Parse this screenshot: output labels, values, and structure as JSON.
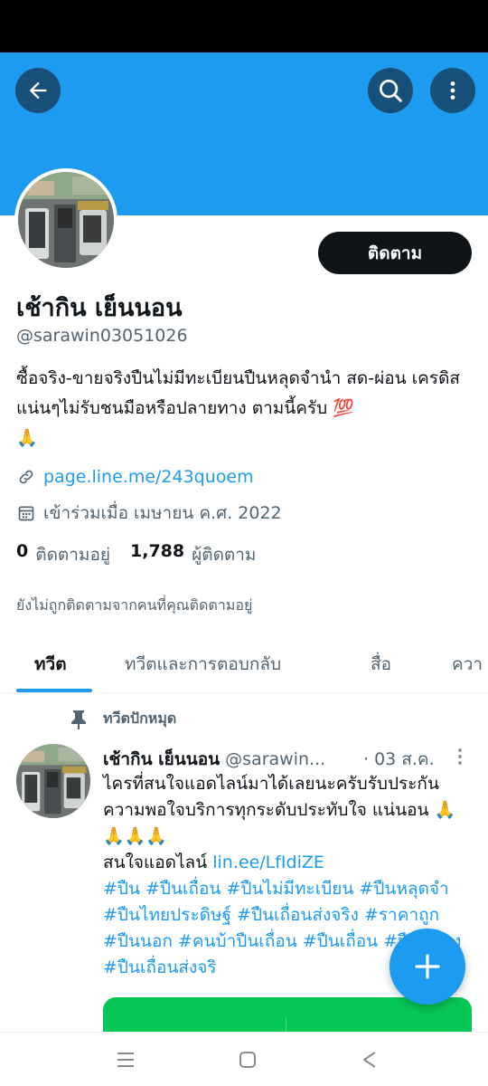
{
  "colors": {
    "accent": "#1d9bf0",
    "banner": "#1d9bf0",
    "header_button": "#19507a",
    "text_primary": "#0f1419",
    "text_secondary": "#536471",
    "line_green": "#06c755"
  },
  "header": {
    "icons": [
      "back-arrow-icon",
      "search-icon",
      "more-vertical-icon"
    ]
  },
  "profile": {
    "follow_label": "ติดตาม",
    "name": "เช้ากิน เย็นนอน",
    "handle": "@sarawin03051026",
    "bio_text": "ซื้อจริง-ขายจริงปืนไม่มีทะเบียนปืนหลุดจำนำ สด-ผ่อน เครดิสแน่นๆไม่รับชนมือหรือปลายทาง ตามนี้ครับ",
    "bio_emoji_100": "💯",
    "bio_emoji_pray": "🙏",
    "link": "page.line.me/243quoem",
    "joined": "เข้าร่วมเมื่อ เมษายน ค.ศ. 2022",
    "following_count": "0",
    "following_label": "ติดตามอยู่",
    "followers_count": "1,788",
    "followers_label": "ผู้ติดตาม",
    "not_followed_note": "ยังไม่ถูกติดตามจากคนที่คุณติดตามอยู่"
  },
  "tabs": [
    {
      "label": "ทวีต",
      "active": true
    },
    {
      "label": "ทวีตและการตอบกลับ",
      "active": false
    },
    {
      "label": "สื่อ",
      "active": false
    },
    {
      "label": "ควา",
      "active": false
    }
  ],
  "pinned_tweet": {
    "pinned_label": "ทวีตปักหมุด",
    "author_name": "เช้ากิน เย็นนอน",
    "author_handle": "@sarawin...",
    "date": "· 03 ส.ค.",
    "line1": "ไครที่สนใจแอดไลน์มาได้เลยนะครับรับประกันความพอใจบริการทุกระดับประทับใจ แน่นอน",
    "pray_emojis": "🙏🙏🙏🙏",
    "line2_prefix": "สนใจแอดไลน์",
    "line2_link": "lin.ee/LfIdiZE",
    "hashtags": "#ปืน #ปืนเถื่อน #ปืนไม่มีทะเบียน #ปืนหลุดจำ #ปืนไทยประดิษฐ์ #ปืนเถื่อนส่งจริง #ราคาถูก #ปืนนอก #คนบ้าปืนเถื่อน #ปืนเถื่อน #ปืนแปลง #ปืนเถื่อนส่งจริ"
  },
  "system_nav": {
    "icons": [
      "recent-apps-icon",
      "home-square-icon",
      "back-triangle-icon"
    ]
  }
}
